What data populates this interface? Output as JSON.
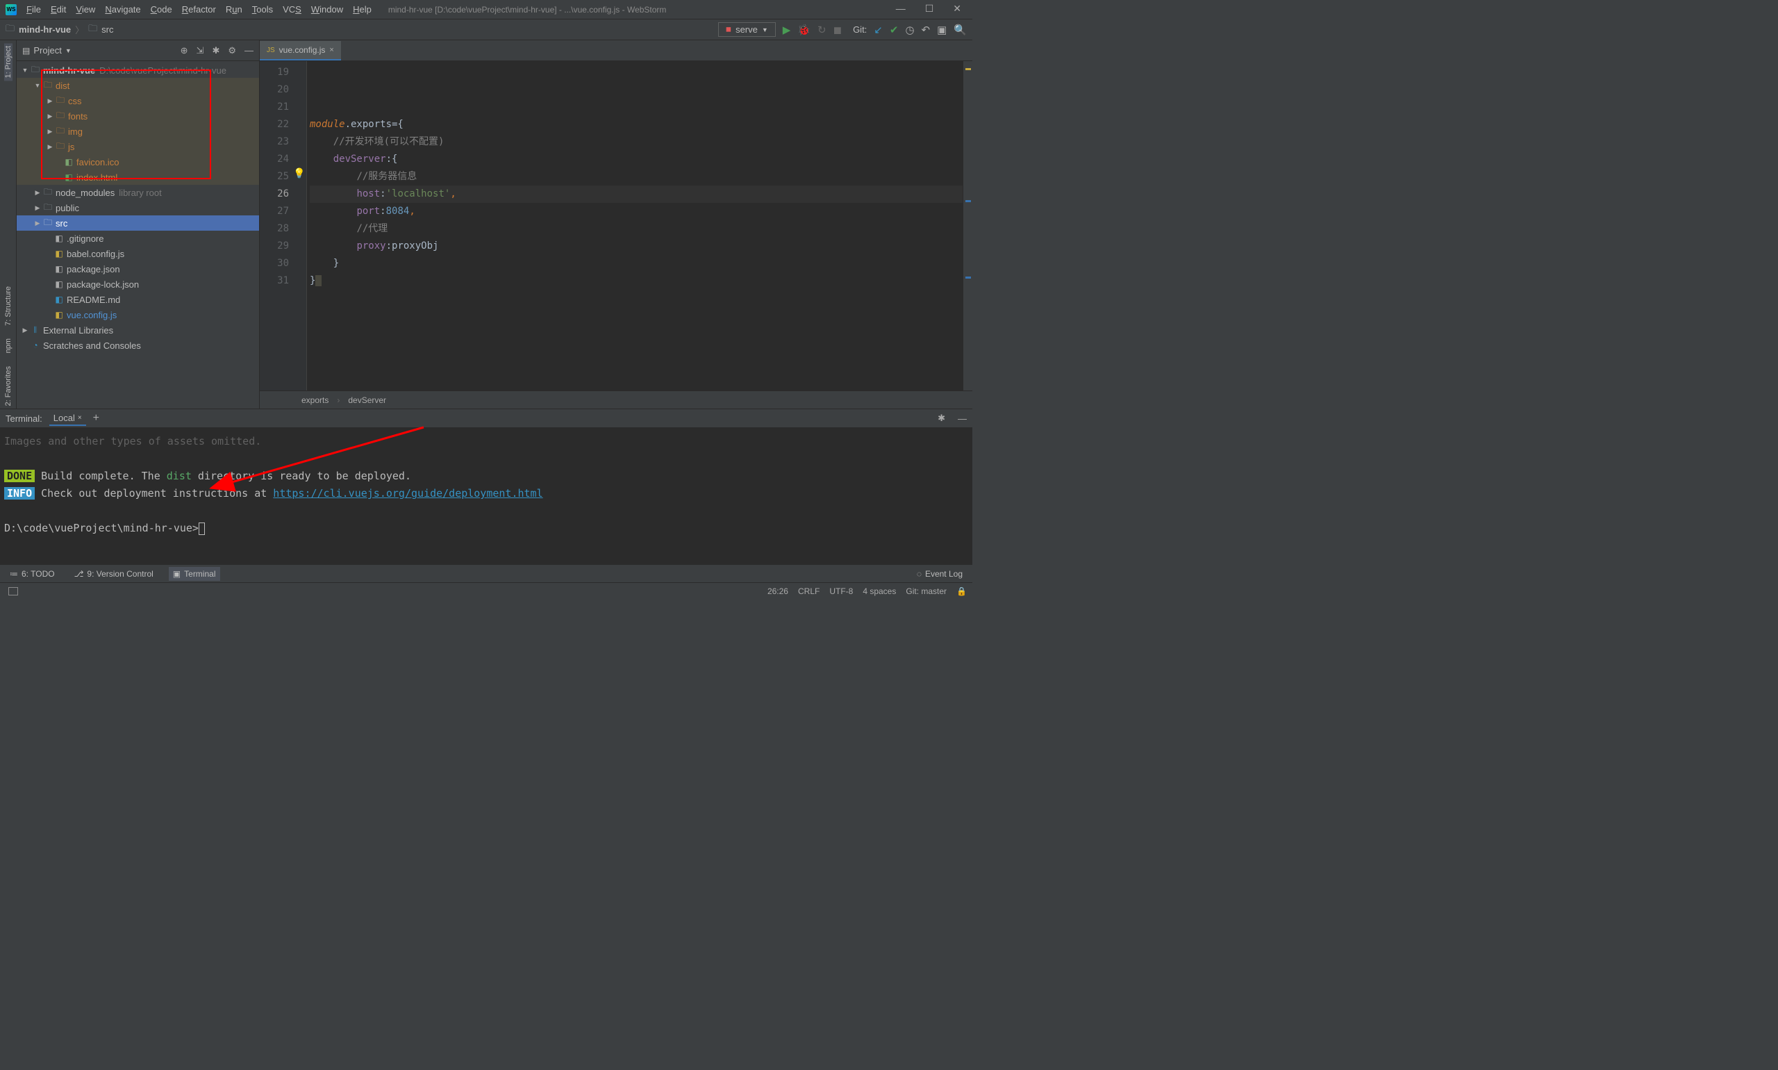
{
  "titlebar": {
    "menu": [
      "File",
      "Edit",
      "View",
      "Navigate",
      "Code",
      "Refactor",
      "Run",
      "Tools",
      "VCS",
      "Window",
      "Help"
    ],
    "title": "mind-hr-vue [D:\\code\\vueProject\\mind-hr-vue] - ...\\vue.config.js - WebStorm"
  },
  "breadcrumb": {
    "root": "mind-hr-vue",
    "src": "src"
  },
  "toolbar": {
    "serve": "serve",
    "git_label": "Git:"
  },
  "project_panel": {
    "title": "Project",
    "root": {
      "name": "mind-hr-vue",
      "path": "D:\\code\\vueProject\\mind-hr-vue"
    },
    "dist": {
      "name": "dist",
      "children": [
        "css",
        "fonts",
        "img",
        "js"
      ],
      "files": [
        "favicon.ico",
        "index.html"
      ]
    },
    "node_modules": {
      "name": "node_modules",
      "tag": "library root"
    },
    "public": "public",
    "src": "src",
    "files": [
      ".gitignore",
      "babel.config.js",
      "package.json",
      "package-lock.json",
      "README.md",
      "vue.config.js"
    ],
    "external": "External Libraries",
    "scratches": "Scratches and Consoles"
  },
  "editor": {
    "tab": "vue.config.js",
    "line_start": 19,
    "lines": [
      "19",
      "20",
      "21",
      "22",
      "23",
      "24",
      "25",
      "26",
      "27",
      "28",
      "29",
      "30",
      "31"
    ],
    "code": {
      "l22a": "module",
      "l22b": ".exports={",
      "l23": "//开发环境(可以不配置)",
      "l24a": "devServer",
      "l24b": ":{",
      "l25": "//服务器信息",
      "l26a": "host",
      "l26b": ":",
      "l26c": "'localhost'",
      "l26d": ",",
      "l27a": "port",
      "l27b": ":",
      "l27c": "8084",
      "l27d": ",",
      "l28": "//代理",
      "l29a": "proxy",
      "l29b": ":proxyObj",
      "l30": "}",
      "l31": "}"
    },
    "crumbs": [
      "exports",
      "devServer"
    ]
  },
  "terminal": {
    "label": "Terminal:",
    "tab": "Local",
    "line_assets": "Images and other types of assets omitted.",
    "badge_done": "DONE",
    "line_done_a": "Build complete. The ",
    "line_done_dist": "dist",
    "line_done_b": " directory is ready to be deployed.",
    "badge_info": "INFO",
    "line_info": "Check out deployment instructions at ",
    "line_info_url": "https://cli.vuejs.org/guide/deployment.html",
    "prompt": "D:\\code\\vueProject\\mind-hr-vue>"
  },
  "bottom_tabs": {
    "todo": "6: TODO",
    "vcs": "9: Version Control",
    "terminal": "Terminal",
    "eventlog": "Event Log"
  },
  "gutters": {
    "project": "1: Project",
    "structure": "7: Structure",
    "npm": "npm",
    "favorites": "2: Favorites"
  },
  "statusbar": {
    "pos": "26:26",
    "eol": "CRLF",
    "enc": "UTF-8",
    "indent": "4 spaces",
    "branch": "Git: master"
  }
}
